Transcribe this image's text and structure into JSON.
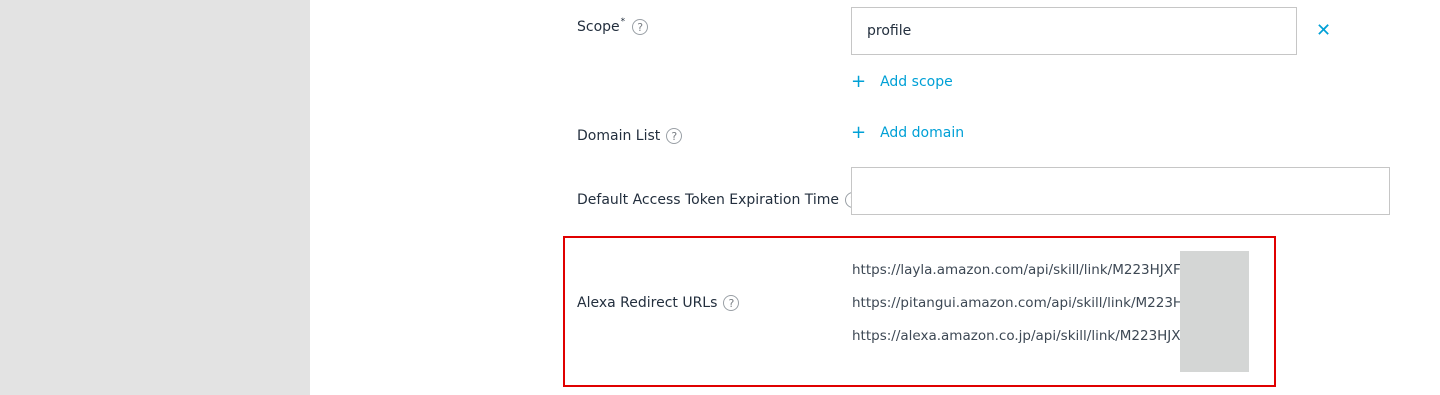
{
  "scope": {
    "label": "Scope",
    "required_mark": "*",
    "help": "?",
    "value": "profile",
    "remove_glyph": "✕",
    "add_plus": "+",
    "add_label": "Add scope"
  },
  "domain_list": {
    "label": "Domain List",
    "help": "?",
    "add_plus": "+",
    "add_label": "Add domain"
  },
  "token_expiration": {
    "label": "Default Access Token Expiration Time",
    "help": "?",
    "value": ""
  },
  "redirect_urls": {
    "label": "Alexa Redirect URLs",
    "help": "?",
    "urls": [
      "https://layla.amazon.com/api/skill/link/M223HJXFT",
      "https://pitangui.amazon.com/api/skill/link/M223HJ",
      "https://alexa.amazon.co.jp/api/skill/link/M223HJXF"
    ]
  },
  "colors": {
    "link": "#00a0d6",
    "highlight": "#e00000",
    "sidebar": "#e3e3e3",
    "redaction": "#d4d6d5"
  }
}
